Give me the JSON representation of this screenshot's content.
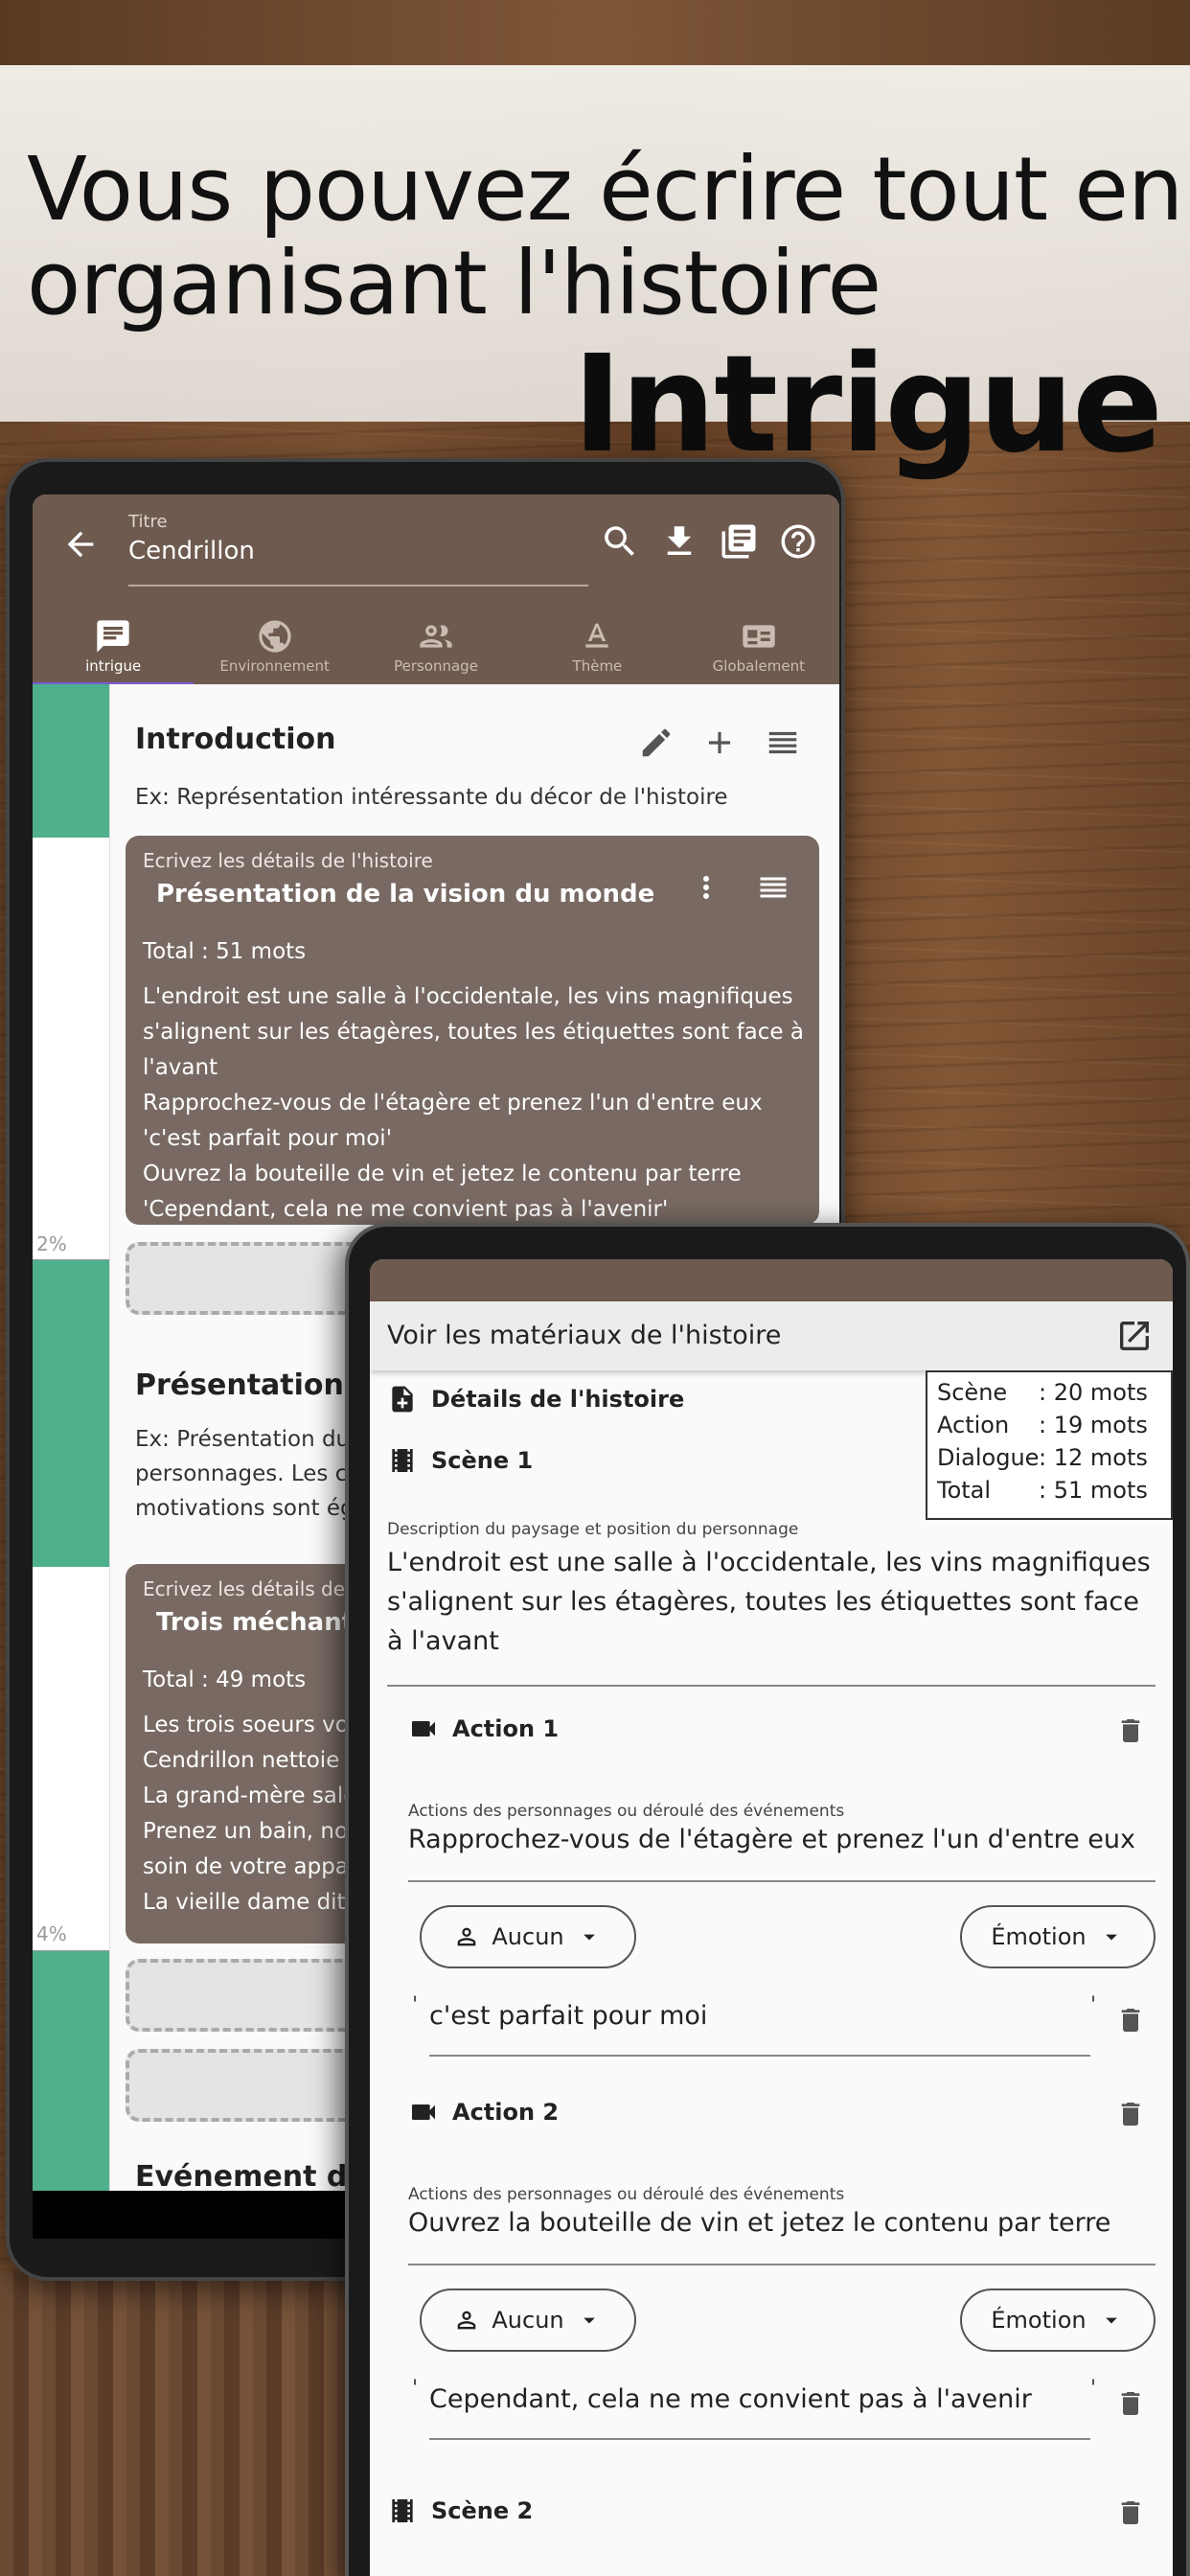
{
  "banner": {
    "line1": "Vous pouvez écrire tout en",
    "line2": "organisant l'histoire",
    "highlight": "Intrigue"
  },
  "app": {
    "title_label": "Titre",
    "title_value": "Cendrillon",
    "tabs": [
      {
        "label": "intrigue",
        "icon": "chat-icon",
        "active": true
      },
      {
        "label": "Environnement",
        "icon": "globe-icon",
        "active": false
      },
      {
        "label": "Personnage",
        "icon": "people-icon",
        "active": false
      },
      {
        "label": "Thème",
        "icon": "text-format-icon",
        "active": false
      },
      {
        "label": "Globalement",
        "icon": "id-card-icon",
        "active": false
      }
    ],
    "strip_percents": [
      "2%",
      "4%"
    ],
    "sections": [
      {
        "title": "Introduction",
        "example": "Ex: Représentation intéressante du décor de l'histoire",
        "card": {
          "label": "Ecrivez les détails de l'histoire",
          "title": "Présentation de la vision du monde",
          "total": "Total : 51 mots",
          "body": "L'endroit est une salle à l'occidentale, les vins magnifiques s'alignent sur les étagères, toutes les étiquettes sont face à l'avant\n Rapprochez-vous de l'étagère et prenez l'un d'entre eux\n 'c'est parfait pour moi'\n Ouvrez la bouteille de vin et jetez le contenu par terre\n 'Cependant, cela ne me convient pas à l'avenir'"
        }
      },
      {
        "title": "Présentation du",
        "example": "Ex: Présentation du\npersonnages. Les ca\nmotivations sont ég",
        "card": {
          "label": "Ecrivez les détails de l",
          "title": "Trois méchants",
          "total": "Total : 49 mots",
          "body": "Les trois soeurs vo\nCendrillon nettoie\nLa grand-mère sale\nPrenez un bain, no\nsoin de votre appa\nLa vieille dame dit"
        }
      },
      {
        "title": "Evénement déc"
      }
    ]
  },
  "materials": {
    "header_title": "Voir les matériaux de l'histoire",
    "stats": [
      {
        "k": "Scène",
        "v": ": 20 mots"
      },
      {
        "k": "Action",
        "v": ": 19 mots"
      },
      {
        "k": "Dialogue",
        "v": ": 12 mots"
      },
      {
        "k": "Total",
        "v": ": 51 mots"
      }
    ],
    "details_label": "Détails de l'histoire",
    "scene1_label": "Scène 1",
    "scene_desc_label": "Description du paysage et position du personnage",
    "scene_desc_value": "L'endroit est une salle à l'occidentale, les vins magnifiques s'alignent sur les étagères, toutes les étiquettes sont face à l'avant",
    "actions": [
      {
        "label": "Action 1",
        "field_label": "Actions des personnages ou déroulé des événements",
        "field_value": "Rapprochez-vous de l'étagère et prenez l'un d'entre eux",
        "character": "Aucun",
        "emotion": "Émotion",
        "dialogue": "c'est parfait pour moi"
      },
      {
        "label": "Action 2",
        "field_label": "Actions des personnages ou déroulé des événements",
        "field_value": "Ouvrez la bouteille de vin et jetez le contenu par terre",
        "character": "Aucun",
        "emotion": "Émotion",
        "dialogue": "Cependant, cela ne me convient pas à l'avenir"
      }
    ],
    "scene2_label": "Scène 2",
    "quote_mark": "'"
  },
  "colors": {
    "appbar": "#6e5a4f",
    "card": "#786a63",
    "strip_green": "#4fb08c",
    "tab_indicator": "#7a5ad6"
  }
}
